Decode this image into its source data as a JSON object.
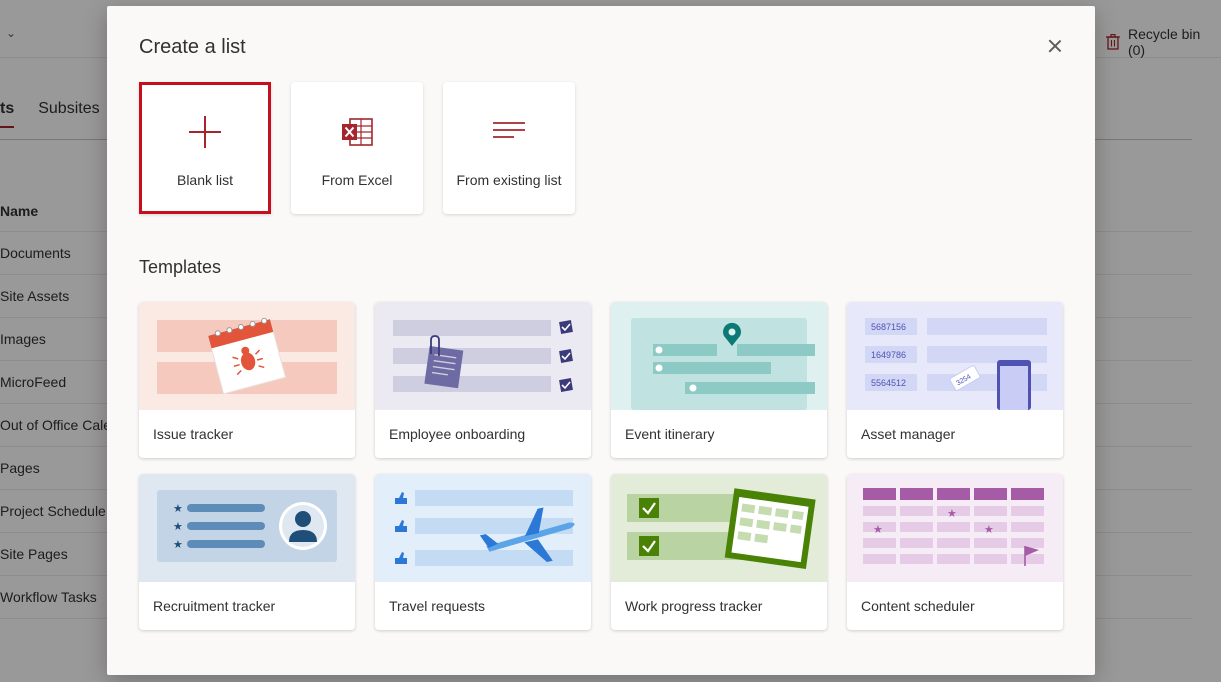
{
  "background": {
    "recycle_bin_label": "Recycle bin (0)",
    "tabs": [
      {
        "label": "ts",
        "active": true
      },
      {
        "label": "Subsites",
        "active": false
      }
    ],
    "list_header": "Name",
    "list_items": [
      "Documents",
      "Site Assets",
      "Images",
      "MicroFeed",
      "Out of Office Cale",
      "Pages",
      "Project Schedule",
      "Site Pages",
      "Workflow Tasks"
    ]
  },
  "dialog": {
    "title": "Create a list",
    "close_icon": "close-icon",
    "create_options": [
      {
        "label": "Blank list",
        "icon": "plus-icon",
        "selected": true
      },
      {
        "label": "From Excel",
        "icon": "excel-icon",
        "selected": false
      },
      {
        "label": "From existing list",
        "icon": "list-lines-icon",
        "selected": false
      }
    ],
    "templates_title": "Templates",
    "templates": [
      {
        "label": "Issue tracker"
      },
      {
        "label": "Employee onboarding"
      },
      {
        "label": "Event itinerary"
      },
      {
        "label": "Asset manager"
      },
      {
        "label": "Recruitment tracker"
      },
      {
        "label": "Travel requests"
      },
      {
        "label": "Work progress tracker"
      },
      {
        "label": "Content scheduler"
      }
    ],
    "asset_numbers": [
      "5687156",
      "1649786",
      "5564512"
    ],
    "asset_tag": "3254"
  },
  "colors": {
    "accent": "#a4262c",
    "selected_border": "#c50f1f",
    "dialog_bg": "#faf9f8"
  }
}
